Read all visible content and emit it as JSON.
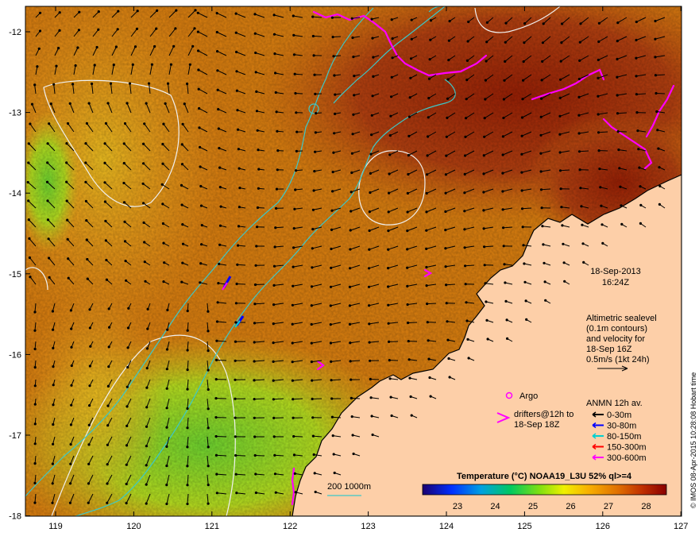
{
  "map": {
    "date": "18-Sep-2013",
    "time": "16:24Z",
    "altimetry_lines": [
      "Altimetric sealevel",
      "(0.1m contours)",
      "and velocity for",
      "18-Sep 16Z",
      "0.5m/s (1kt 24h)"
    ],
    "argo_label": "Argo",
    "drifters_lines": [
      "drifters@12h to",
      "18-Sep 18Z"
    ],
    "anmn_title": "ANMN 12h av.",
    "anmn_items": [
      {
        "label": "0-30m",
        "color": "#000000"
      },
      {
        "label": "30-80m",
        "color": "#0000ff"
      },
      {
        "label": "80-150m",
        "color": "#00d0d0"
      },
      {
        "label": "150-300m",
        "color": "#ff0000"
      },
      {
        "label": "300-600m",
        "color": "#ff00ff"
      }
    ],
    "isobath_label": "200  1000m",
    "colorbar_title": "Temperature (°C) NOAA19_L3U 52% ql>=4",
    "colorbar_ticks": [
      "23",
      "24",
      "25",
      "26",
      "27",
      "28"
    ],
    "credit": "© IMOS 08-Apr-2015 10:28:08 Hobart time",
    "lat_ticks": [
      "-12",
      "-13",
      "-14",
      "-15",
      "-16",
      "-17",
      "-18"
    ],
    "lon_ticks": [
      "119",
      "120",
      "121",
      "122",
      "123",
      "124",
      "125",
      "126",
      "127"
    ]
  },
  "colors": {
    "land": "#fdcfa8",
    "coast": "#000000",
    "sea_warm": "#d97a10",
    "sea_hot": "#a02a05",
    "sea_cool": "#9ee020",
    "isobath": "#3cc8c8",
    "contour": "#f0f0f0",
    "drifter": "#ff00ff"
  }
}
